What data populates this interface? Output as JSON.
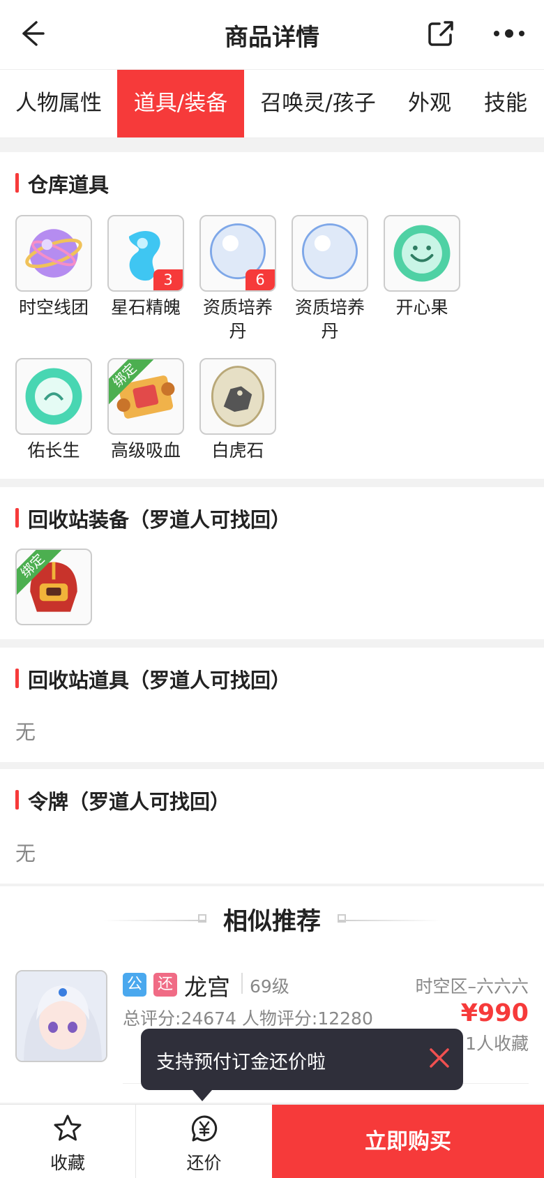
{
  "nav": {
    "title": "商品详情"
  },
  "tabs": [
    {
      "label": "人物属性"
    },
    {
      "label": "道具/装备"
    },
    {
      "label": "召唤灵/孩子"
    },
    {
      "label": "外观"
    },
    {
      "label": "技能"
    }
  ],
  "active_tab": 1,
  "warehouse": {
    "title": "仓库道具",
    "items": [
      {
        "name": "时空线团",
        "icon": "yarn-ball-icon"
      },
      {
        "name": "星石精魄",
        "icon": "blue-spirit-icon",
        "count": "3"
      },
      {
        "name": "资质培养丹",
        "icon": "pearl-icon",
        "count": "6"
      },
      {
        "name": "资质培养丹",
        "icon": "pearl-icon"
      },
      {
        "name": "开心果",
        "icon": "happy-fruit-icon"
      },
      {
        "name": "佑长生",
        "icon": "longevity-icon"
      },
      {
        "name": "高级吸血",
        "icon": "scroll-icon",
        "bound_label": "绑定"
      },
      {
        "name": "白虎石",
        "icon": "white-tiger-stone-icon"
      }
    ]
  },
  "recycle_equipment": {
    "title": "回收站装备（罗道人可找回）",
    "items": [
      {
        "icon": "helmet-icon",
        "bound_label": "绑定"
      }
    ]
  },
  "recycle_items": {
    "title": "回收站道具（罗道人可找回）",
    "empty_text": "无"
  },
  "token": {
    "title": "令牌（罗道人可找回）",
    "empty_text": "无"
  },
  "recommend": {
    "title": "相似推荐",
    "listing": {
      "tag_public": "公",
      "tag_bargain": "还",
      "name": "龙宫",
      "level": "69级",
      "server": "时空区–六六六",
      "score": "总评分:24674 人物评分:12280",
      "price": "¥990",
      "favorites": "1人收藏"
    }
  },
  "tooltip": {
    "text": "支持预付订金还价啦"
  },
  "bottom_bar": {
    "favorite_label": "收藏",
    "bargain_label": "还价",
    "buy_label": "立即购买"
  },
  "colors": {
    "accent": "#f63a3a",
    "tag_public": "#4aa8ee",
    "tag_bargain": "#f06b85",
    "bound": "#4caf50"
  }
}
